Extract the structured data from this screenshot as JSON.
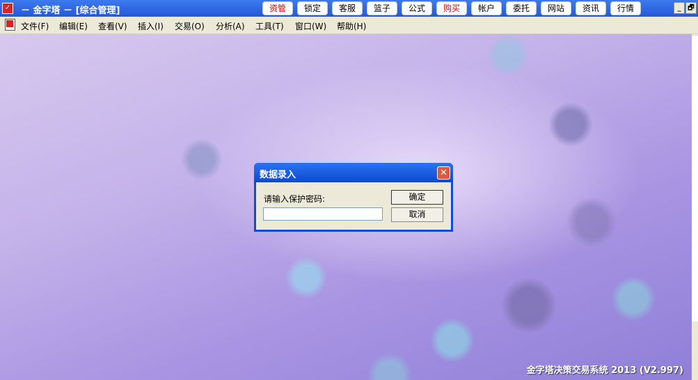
{
  "window": {
    "title": "－ 金字塔 － [综合管理]",
    "icon": "app-chart-icon"
  },
  "toolbar_buttons": [
    {
      "label": "资管",
      "highlight": true
    },
    {
      "label": "锁定"
    },
    {
      "label": "客服"
    },
    {
      "label": "篮子"
    },
    {
      "label": "公式"
    },
    {
      "label": "购买",
      "highlight": true
    },
    {
      "label": "帐户"
    },
    {
      "label": "委托"
    },
    {
      "label": "网站"
    },
    {
      "label": "资讯"
    },
    {
      "label": "行情"
    }
  ],
  "window_controls": {
    "minimize": "_",
    "restore": "🗗"
  },
  "menu": [
    "文件(F)",
    "编辑(E)",
    "查看(V)",
    "插入(I)",
    "交易(O)",
    "分析(A)",
    "工具(T)",
    "窗口(W)",
    "帮助(H)"
  ],
  "mdi_controls": {
    "minimize": "_",
    "restore": "🗗"
  },
  "dialog": {
    "title": "数据录入",
    "close": "✕",
    "label": "请输入保护密码:",
    "password": "",
    "ok": "确定",
    "cancel": "取消"
  },
  "footer": "金字塔决策交易系统 2013 (V2.997)",
  "colors": {
    "titlebar": "#2458d8",
    "highlight_text": "#dd0000"
  }
}
